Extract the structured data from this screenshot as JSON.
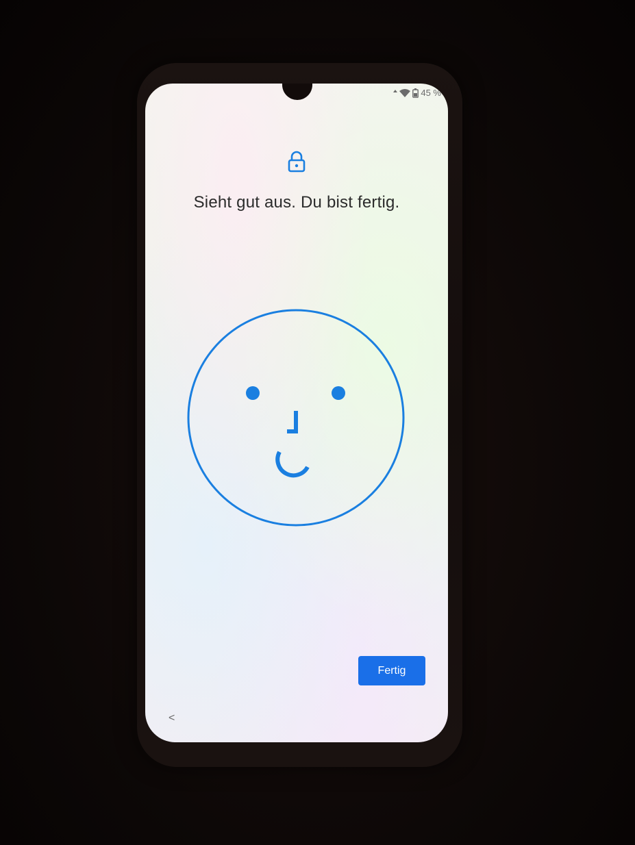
{
  "status_bar": {
    "icons": [
      "data-arrows-icon",
      "wifi-icon",
      "battery-icon"
    ],
    "battery_text": "45 %"
  },
  "screen": {
    "lock_icon": "lock-icon",
    "headline": "Sieht gut aus. Du bist fertig.",
    "face_icon": "face-recognition-icon",
    "accent_color": "#1a7fe0"
  },
  "actions": {
    "done_label": "Fertig",
    "done_color": "#1a6fe8"
  },
  "navigation": {
    "back_glyph": "<",
    "back_icon": "chevron-left-icon"
  }
}
